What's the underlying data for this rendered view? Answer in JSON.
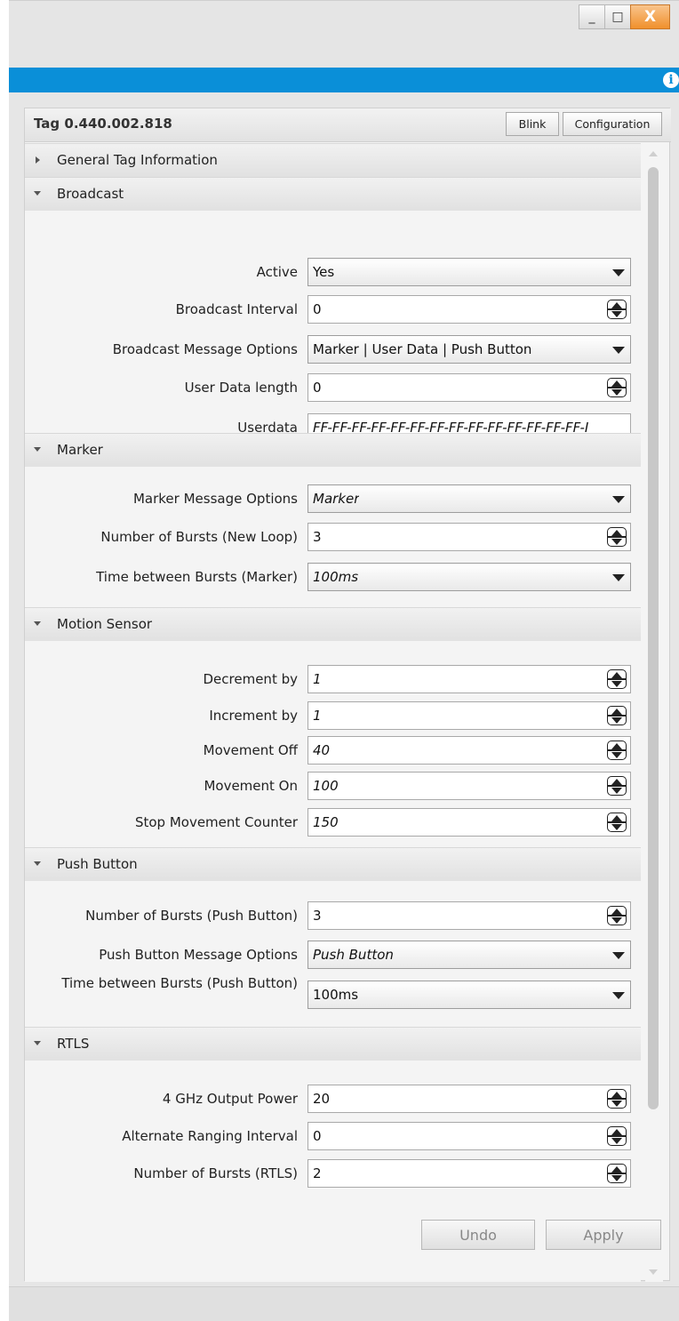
{
  "window": {
    "minimize_label": "_",
    "maximize_label": "□",
    "close_label": "X"
  },
  "infobar": {
    "icon": "info-icon",
    "icon_glyph": "i",
    "accent": "#0a8fd8"
  },
  "panel": {
    "title": "Tag 0.440.002.818",
    "blink_label": "Blink",
    "configuration_label": "Configuration"
  },
  "sections": {
    "general": {
      "title": "General Tag Information",
      "expanded": false
    },
    "broadcast": {
      "title": "Broadcast",
      "expanded": true,
      "rows": [
        {
          "label": "Active",
          "value": "Yes",
          "type": "dropdown"
        },
        {
          "label": "Broadcast Interval",
          "value": "0",
          "type": "spinner"
        },
        {
          "label": "Broadcast Message Options",
          "value": "Marker | User Data | Push Button",
          "type": "dropdown"
        },
        {
          "label": "User Data length",
          "value": "0",
          "type": "spinner"
        },
        {
          "label": "Userdata",
          "value": "FF-FF-FF-FF-FF-FF-FF-FF-FF-FF-FF-FF-FF-FF-I",
          "type": "text"
        }
      ]
    },
    "marker": {
      "title": "Marker",
      "expanded": true,
      "rows": [
        {
          "label": "Marker Message Options",
          "value": "Marker",
          "type": "dropdown"
        },
        {
          "label": "Number of Bursts (New Loop)",
          "value": "3",
          "type": "spinner"
        },
        {
          "label": "Time between Bursts (Marker)",
          "value": "100ms",
          "type": "dropdown"
        }
      ]
    },
    "motion": {
      "title": "Motion Sensor",
      "expanded": true,
      "rows": [
        {
          "label": "Decrement by",
          "value": "1",
          "type": "spinner"
        },
        {
          "label": "Increment by",
          "value": "1",
          "type": "spinner"
        },
        {
          "label": "Movement Off",
          "value": "40",
          "type": "spinner"
        },
        {
          "label": "Movement On",
          "value": "100",
          "type": "spinner"
        },
        {
          "label": "Stop Movement Counter",
          "value": "150",
          "type": "spinner"
        }
      ]
    },
    "push": {
      "title": "Push Button",
      "expanded": true,
      "rows": [
        {
          "label": "Number of Bursts (Push Button)",
          "value": "3",
          "type": "spinner"
        },
        {
          "label": "Push Button Message Options",
          "value": "Push Button",
          "type": "dropdown"
        },
        {
          "label": "Time between Bursts (Push Button)",
          "value": "100ms",
          "type": "dropdown"
        }
      ]
    },
    "rtls": {
      "title": "RTLS",
      "expanded": true,
      "rows": [
        {
          "label": "4 GHz Output Power",
          "value": "20",
          "type": "spinner"
        },
        {
          "label": "Alternate Ranging Interval",
          "value": "0",
          "type": "spinner"
        },
        {
          "label": "Number of Bursts (RTLS)",
          "value": "2",
          "type": "spinner"
        }
      ]
    }
  },
  "footer": {
    "undo_label": "Undo",
    "apply_label": "Apply"
  }
}
